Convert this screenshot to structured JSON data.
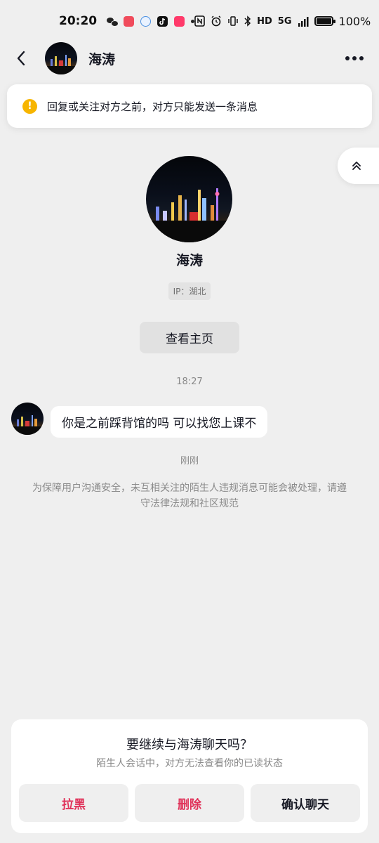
{
  "status_bar": {
    "time": "20:20",
    "network": "5G",
    "hd": "HD",
    "battery": "100%"
  },
  "header": {
    "title": "海涛"
  },
  "notice": {
    "icon": "!",
    "text": "回复或关注对方之前，对方只能发送一条消息"
  },
  "profile": {
    "name": "海涛",
    "ip": "IP：湖北",
    "homepage_button": "查看主页"
  },
  "messages": {
    "time_1": "18:27",
    "text_1": "你是之前踩背馆的吗 可以找您上课不",
    "time_2": "刚刚",
    "safety_note": "为保障用户沟通安全，未互相关注的陌生人违规消息可能会被处理，请遵守法律法规和社区规范"
  },
  "sheet": {
    "title": "要继续与海涛聊天吗？",
    "subtitle": "陌生人会话中，对方无法查看你的已读状态",
    "block_label": "拉黑",
    "delete_label": "删除",
    "confirm_label": "确认聊天"
  },
  "colors": {
    "background": "#efefef",
    "danger": "#e0335a",
    "warning": "#f7b500"
  }
}
